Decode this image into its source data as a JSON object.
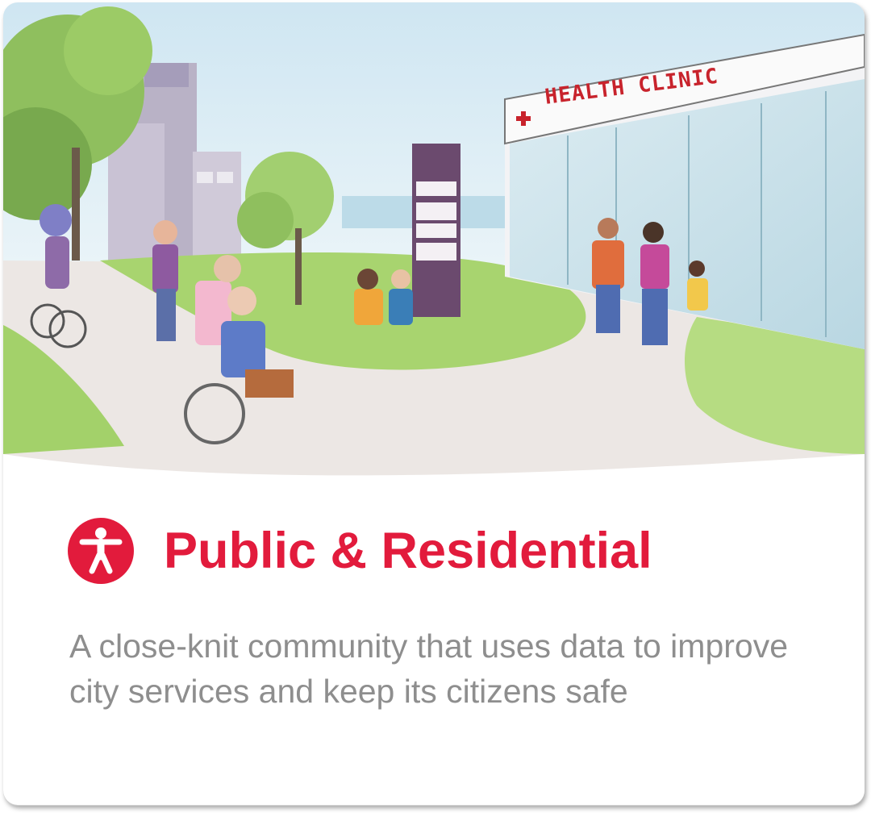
{
  "card": {
    "title": "Public & Residential",
    "description": "A close-knit community that uses data to improve city services and keep its citizens safe",
    "icon": "accessibility-icon",
    "accent_color": "#e21b3c"
  },
  "illustration": {
    "sign_text": "HEALTH CLINIC"
  }
}
